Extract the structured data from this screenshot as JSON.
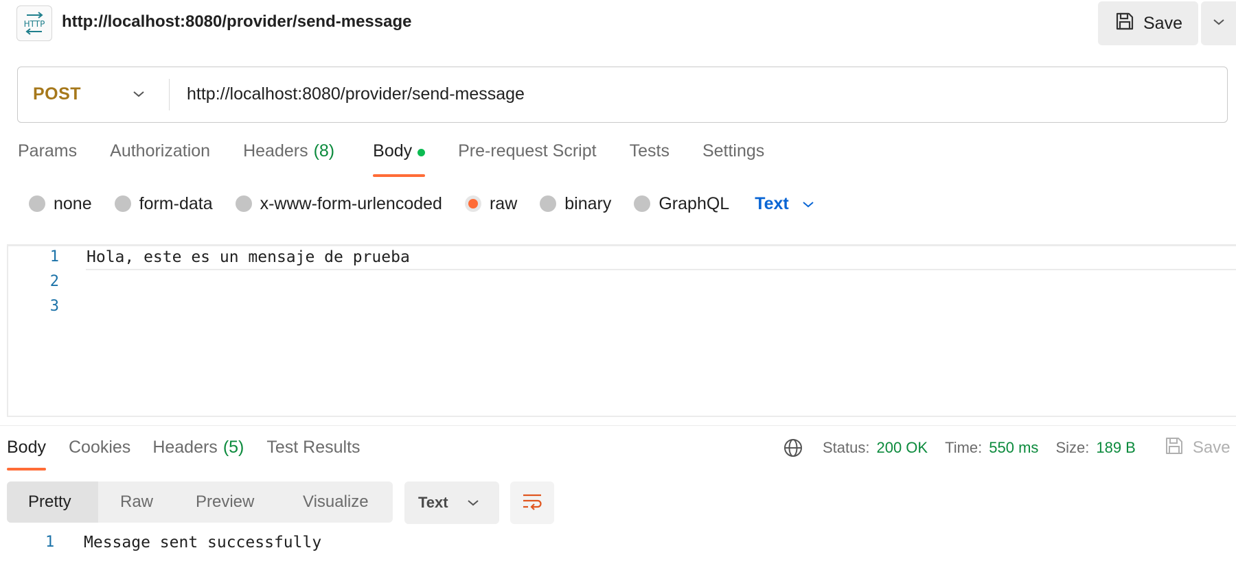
{
  "header": {
    "badge_icon": "http-icon",
    "title": "http://localhost:8080/provider/send-message",
    "save_label": "Save"
  },
  "request": {
    "method": "POST",
    "method_color": "#a6781b",
    "url": "http://localhost:8080/provider/send-message"
  },
  "request_tabs": [
    {
      "label": "Params"
    },
    {
      "label": "Authorization"
    },
    {
      "label": "Headers",
      "count": "(8)"
    },
    {
      "label": "Body",
      "active": true,
      "dot": true
    },
    {
      "label": "Pre-request Script"
    },
    {
      "label": "Tests"
    },
    {
      "label": "Settings"
    }
  ],
  "body_types": [
    {
      "label": "none",
      "selected": false
    },
    {
      "label": "form-data",
      "selected": false
    },
    {
      "label": "x-www-form-urlencoded",
      "selected": false
    },
    {
      "label": "raw",
      "selected": true
    },
    {
      "label": "binary",
      "selected": false
    },
    {
      "label": "GraphQL",
      "selected": false
    }
  ],
  "raw_format": "Text",
  "editor": {
    "lines": [
      {
        "no": "1",
        "text": "Hola, este es un mensaje de prueba"
      },
      {
        "no": "2",
        "text": ""
      },
      {
        "no": "3",
        "text": ""
      }
    ]
  },
  "response": {
    "tabs": [
      {
        "label": "Body",
        "active": true
      },
      {
        "label": "Cookies"
      },
      {
        "label": "Headers",
        "count": "(5)"
      },
      {
        "label": "Test Results"
      }
    ],
    "status_label": "Status:",
    "status_value": "200 OK",
    "time_label": "Time:",
    "time_value": "550 ms",
    "size_label": "Size:",
    "size_value": "189 B",
    "save_label": "Save",
    "views": [
      "Pretty",
      "Raw",
      "Preview",
      "Visualize"
    ],
    "active_view": "Pretty",
    "format": "Text",
    "body_line_no": "1",
    "body_text": "Message sent successfully"
  },
  "colors": {
    "accent": "#ff6c37",
    "success": "#0b8a3c",
    "link": "#0965d4"
  }
}
